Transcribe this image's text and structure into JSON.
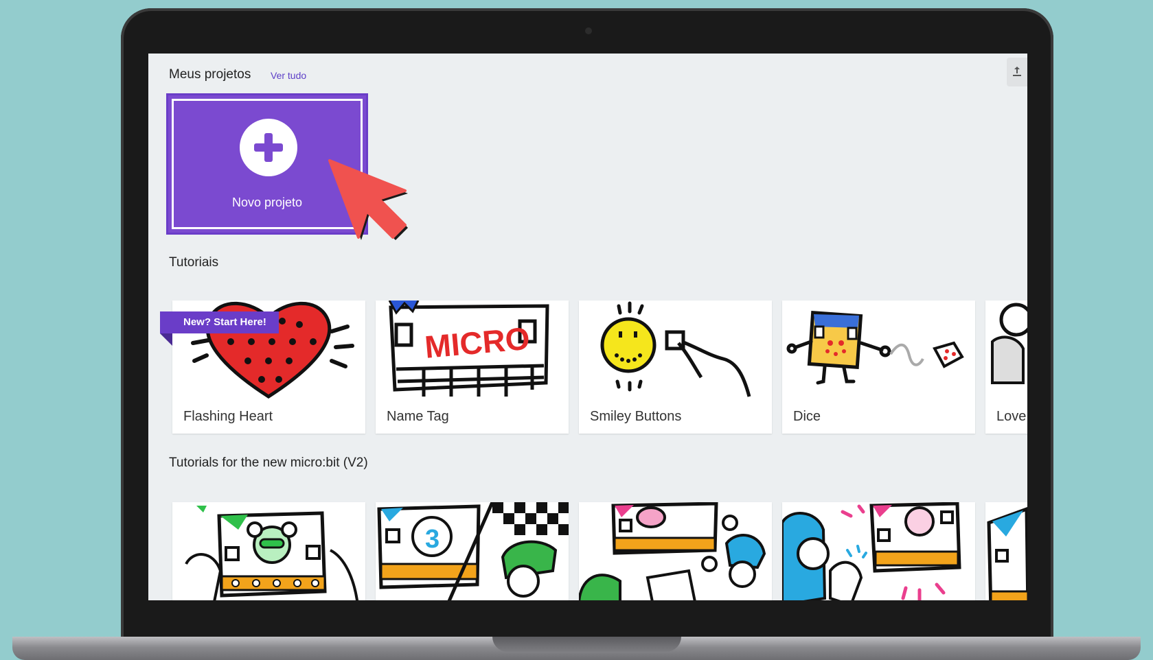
{
  "my_projects": {
    "title": "Meus projetos",
    "view_all": "Ver tudo",
    "new_project_label": "Novo projeto"
  },
  "tutorials": {
    "title": "Tutoriais",
    "badge": "New? Start Here!",
    "items": [
      {
        "label": "Flashing Heart",
        "icon": "heart-illustration"
      },
      {
        "label": "Name Tag",
        "icon": "micro-name-tag-illustration"
      },
      {
        "label": "Smiley Buttons",
        "icon": "smiley-buttons-illustration"
      },
      {
        "label": "Dice",
        "icon": "dice-illustration"
      },
      {
        "label": "Love",
        "icon": "love-meter-illustration"
      }
    ]
  },
  "v2_tutorials": {
    "title": "Tutorials for the new micro:bit (V2)",
    "items": [
      {
        "icon": "mouse-microbit-illustration"
      },
      {
        "icon": "countdown-race-illustration"
      },
      {
        "icon": "pig-microbit-illustration"
      },
      {
        "icon": "lightbulb-clapping-illustration"
      },
      {
        "icon": "microbit-partial-illustration"
      }
    ]
  },
  "colors": {
    "accent": "#7b4ad0",
    "cursor": "#f0524f",
    "background": "#93cccd",
    "screen": "#eceff1"
  }
}
